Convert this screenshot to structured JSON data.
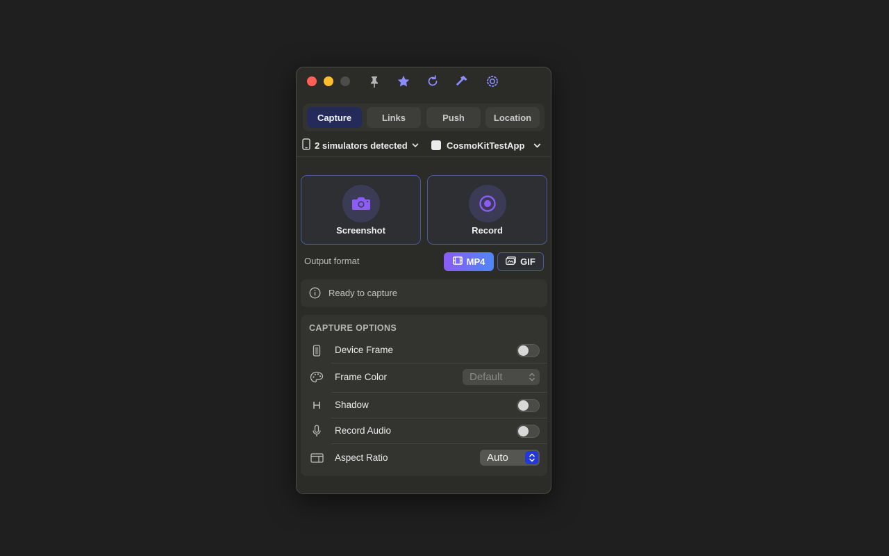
{
  "toolbar": {
    "icons": [
      "pin-icon",
      "star-icon",
      "refresh-icon",
      "hammer-icon",
      "settings-icon"
    ]
  },
  "tabs": [
    {
      "label": "Capture",
      "active": true
    },
    {
      "label": "Links",
      "active": false
    },
    {
      "label": "Push",
      "active": false
    },
    {
      "label": "Location",
      "active": false
    }
  ],
  "simulators": {
    "label": "2 simulators detected",
    "app_name": "CosmoKitTestApp"
  },
  "capture": {
    "screenshot_label": "Screenshot",
    "record_label": "Record"
  },
  "output_format": {
    "label": "Output format",
    "options": [
      "MP4",
      "GIF"
    ],
    "selected": "MP4"
  },
  "status": {
    "text": "Ready to capture"
  },
  "capture_options": {
    "header": "CAPTURE OPTIONS",
    "device_frame": {
      "label": "Device Frame",
      "enabled": false
    },
    "frame_color": {
      "label": "Frame Color",
      "value": "Default",
      "disabled": true
    },
    "shadow": {
      "label": "Shadow",
      "enabled": false
    },
    "record_audio": {
      "label": "Record Audio",
      "enabled": false
    },
    "aspect_ratio": {
      "label": "Aspect Ratio",
      "value": "Auto"
    }
  },
  "colors": {
    "accent": "#8b8cff",
    "active_tab": "#242a5a",
    "capture_purple": "#8b5cf6",
    "select_blue": "#2438d8"
  }
}
